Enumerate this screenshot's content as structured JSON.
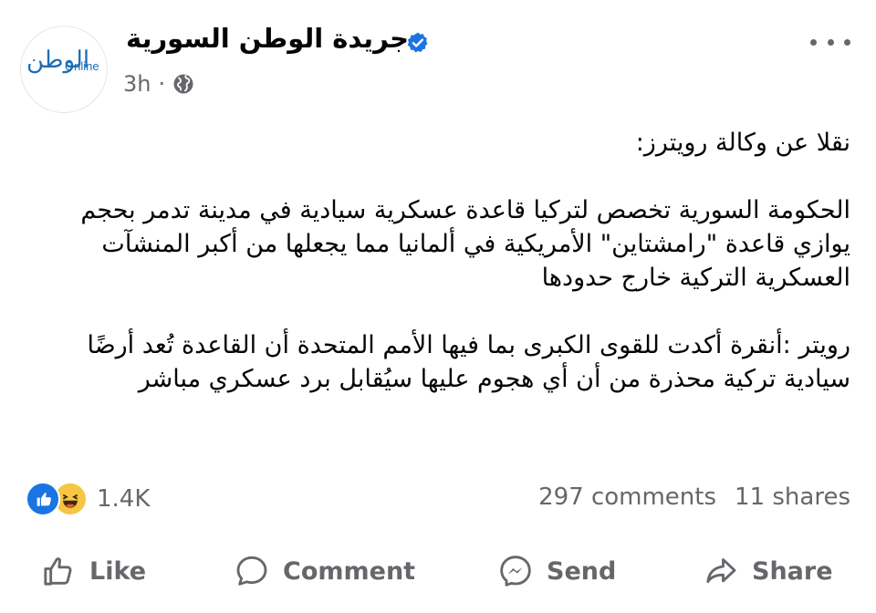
{
  "post": {
    "avatar_logo_ar": "الوطن",
    "avatar_logo_en": "Online",
    "page_name": "جريدة الوطن السورية",
    "time": "3h",
    "separator": "·",
    "paragraphs": [
      "نقلا عن وكالة رويترز:",
      "الحكومة السورية تخصص لتركيا قاعدة عسكرية سيادية في مدينة تدمر بحجم يوازي قاعدة \"رامشتاين\" الأمريكية في ألمانيا مما يجعلها من أكبر المنشآت العسكرية التركية خارج حدودها",
      "رويتر :أنقرة أكدت للقوى الكبرى بما فيها الأمم المتحدة أن القاعدة تُعد أرضًا سيادية تركية محذرة من أن أي هجوم عليها سيُقابل برد عسكري مباشر"
    ]
  },
  "engagement": {
    "reaction_count": "1.4K",
    "comments": "297 comments",
    "shares": "11 shares",
    "reaction_icons": [
      "like-icon",
      "haha-icon"
    ]
  },
  "actions": {
    "like": "Like",
    "comment": "Comment",
    "send": "Send",
    "share": "Share"
  },
  "colors": {
    "accent": "#1b74e4",
    "secondary_text": "#65676b",
    "haha": "#f7c544"
  }
}
